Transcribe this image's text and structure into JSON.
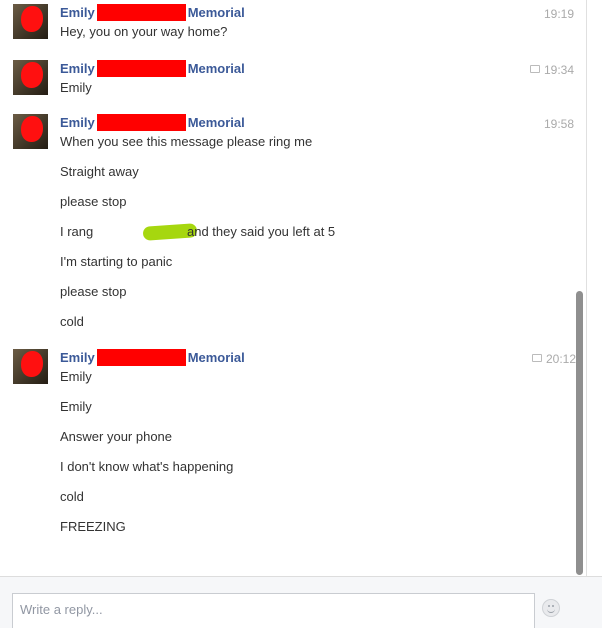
{
  "thread": {
    "groups": [
      {
        "sender_first": "Emily",
        "sender_last": "Memorial",
        "time": "19:19",
        "messages": [
          "Hey, you on your way home?"
        ]
      },
      {
        "sender_first": "Emily",
        "sender_last": "Memorial",
        "time": "19:34",
        "messages": [
          "Emily"
        ]
      },
      {
        "sender_first": "Emily",
        "sender_last": "Memorial",
        "time": "19:58",
        "messages": [
          "When you see this message please ring me",
          "Straight away",
          "please stop",
          "I rang",
          "and they said you left at 5",
          "I'm starting to panic",
          "please stop",
          "cold"
        ]
      },
      {
        "sender_first": "Emily",
        "sender_last": "Memorial",
        "time": "20:12",
        "messages": [
          "Emily",
          "Emily",
          "Answer your phone",
          "I don't know what's happening",
          "cold",
          "FREEZING"
        ]
      }
    ]
  },
  "composer": {
    "placeholder": "Write a reply..."
  },
  "colors": {
    "sender": "#3b5998",
    "redaction": "#ff0000",
    "scribble": "#a6d70f"
  },
  "icons": [
    "chat-bubble-icon",
    "emoji-icon"
  ]
}
